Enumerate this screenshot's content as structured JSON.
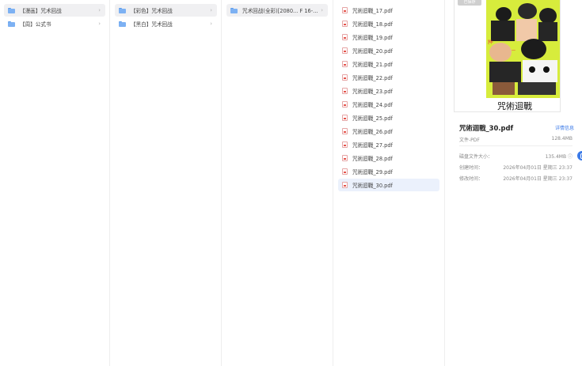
{
  "column1": {
    "items": [
      {
        "label": "【漫画】咒术回战",
        "state": "open"
      },
      {
        "label": "【周】公式书",
        "state": "normal"
      }
    ]
  },
  "column2": {
    "items": [
      {
        "label": "【彩色】咒术回战",
        "state": "open"
      },
      {
        "label": "【黑白】咒术回战",
        "state": "normal"
      }
    ]
  },
  "column3": {
    "items": [
      {
        "label": "咒术回战(全彩)[2080... F 16-30",
        "state": "open"
      }
    ]
  },
  "column4": {
    "items": [
      {
        "label": "咒術迴戰_17.pdf"
      },
      {
        "label": "咒術迴戰_18.pdf"
      },
      {
        "label": "咒術迴戰_19.pdf"
      },
      {
        "label": "咒術迴戰_20.pdf"
      },
      {
        "label": "咒術迴戰_21.pdf"
      },
      {
        "label": "咒術迴戰_22.pdf"
      },
      {
        "label": "咒術迴戰_23.pdf"
      },
      {
        "label": "咒術迴戰_24.pdf"
      },
      {
        "label": "咒術迴戰_25.pdf"
      },
      {
        "label": "咒術迴戰_26.pdf"
      },
      {
        "label": "咒術迴戰_27.pdf"
      },
      {
        "label": "咒術迴戰_28.pdf"
      },
      {
        "label": "咒術迴戰_29.pdf"
      },
      {
        "label": "咒術迴戰_30.pdf"
      }
    ],
    "selected_index": 13
  },
  "preview": {
    "cover_tag": "已保存",
    "cover_title": "咒術迴戰",
    "file_title": "咒術迴戰_30.pdf",
    "detail_link": "详情信息",
    "type_label": "文件-PDF",
    "type_size": "128.4MB",
    "meta": [
      {
        "label": "磁盘文件大小：",
        "value": "135.4MB ⓘ"
      },
      {
        "label": "创建时间：",
        "value": "2026年04月01日 星期三 23:37"
      },
      {
        "label": "修改时间：",
        "value": "2026年04月01日 星期三 23:37"
      }
    ]
  },
  "colors": {
    "accent": "#3b7ae8",
    "folder": "#7db1f3",
    "pdf": "#e5534b",
    "selected_row": "#ebf1fc",
    "open_row": "#f0f0f2",
    "cover_bg": "#d7ec3c"
  }
}
